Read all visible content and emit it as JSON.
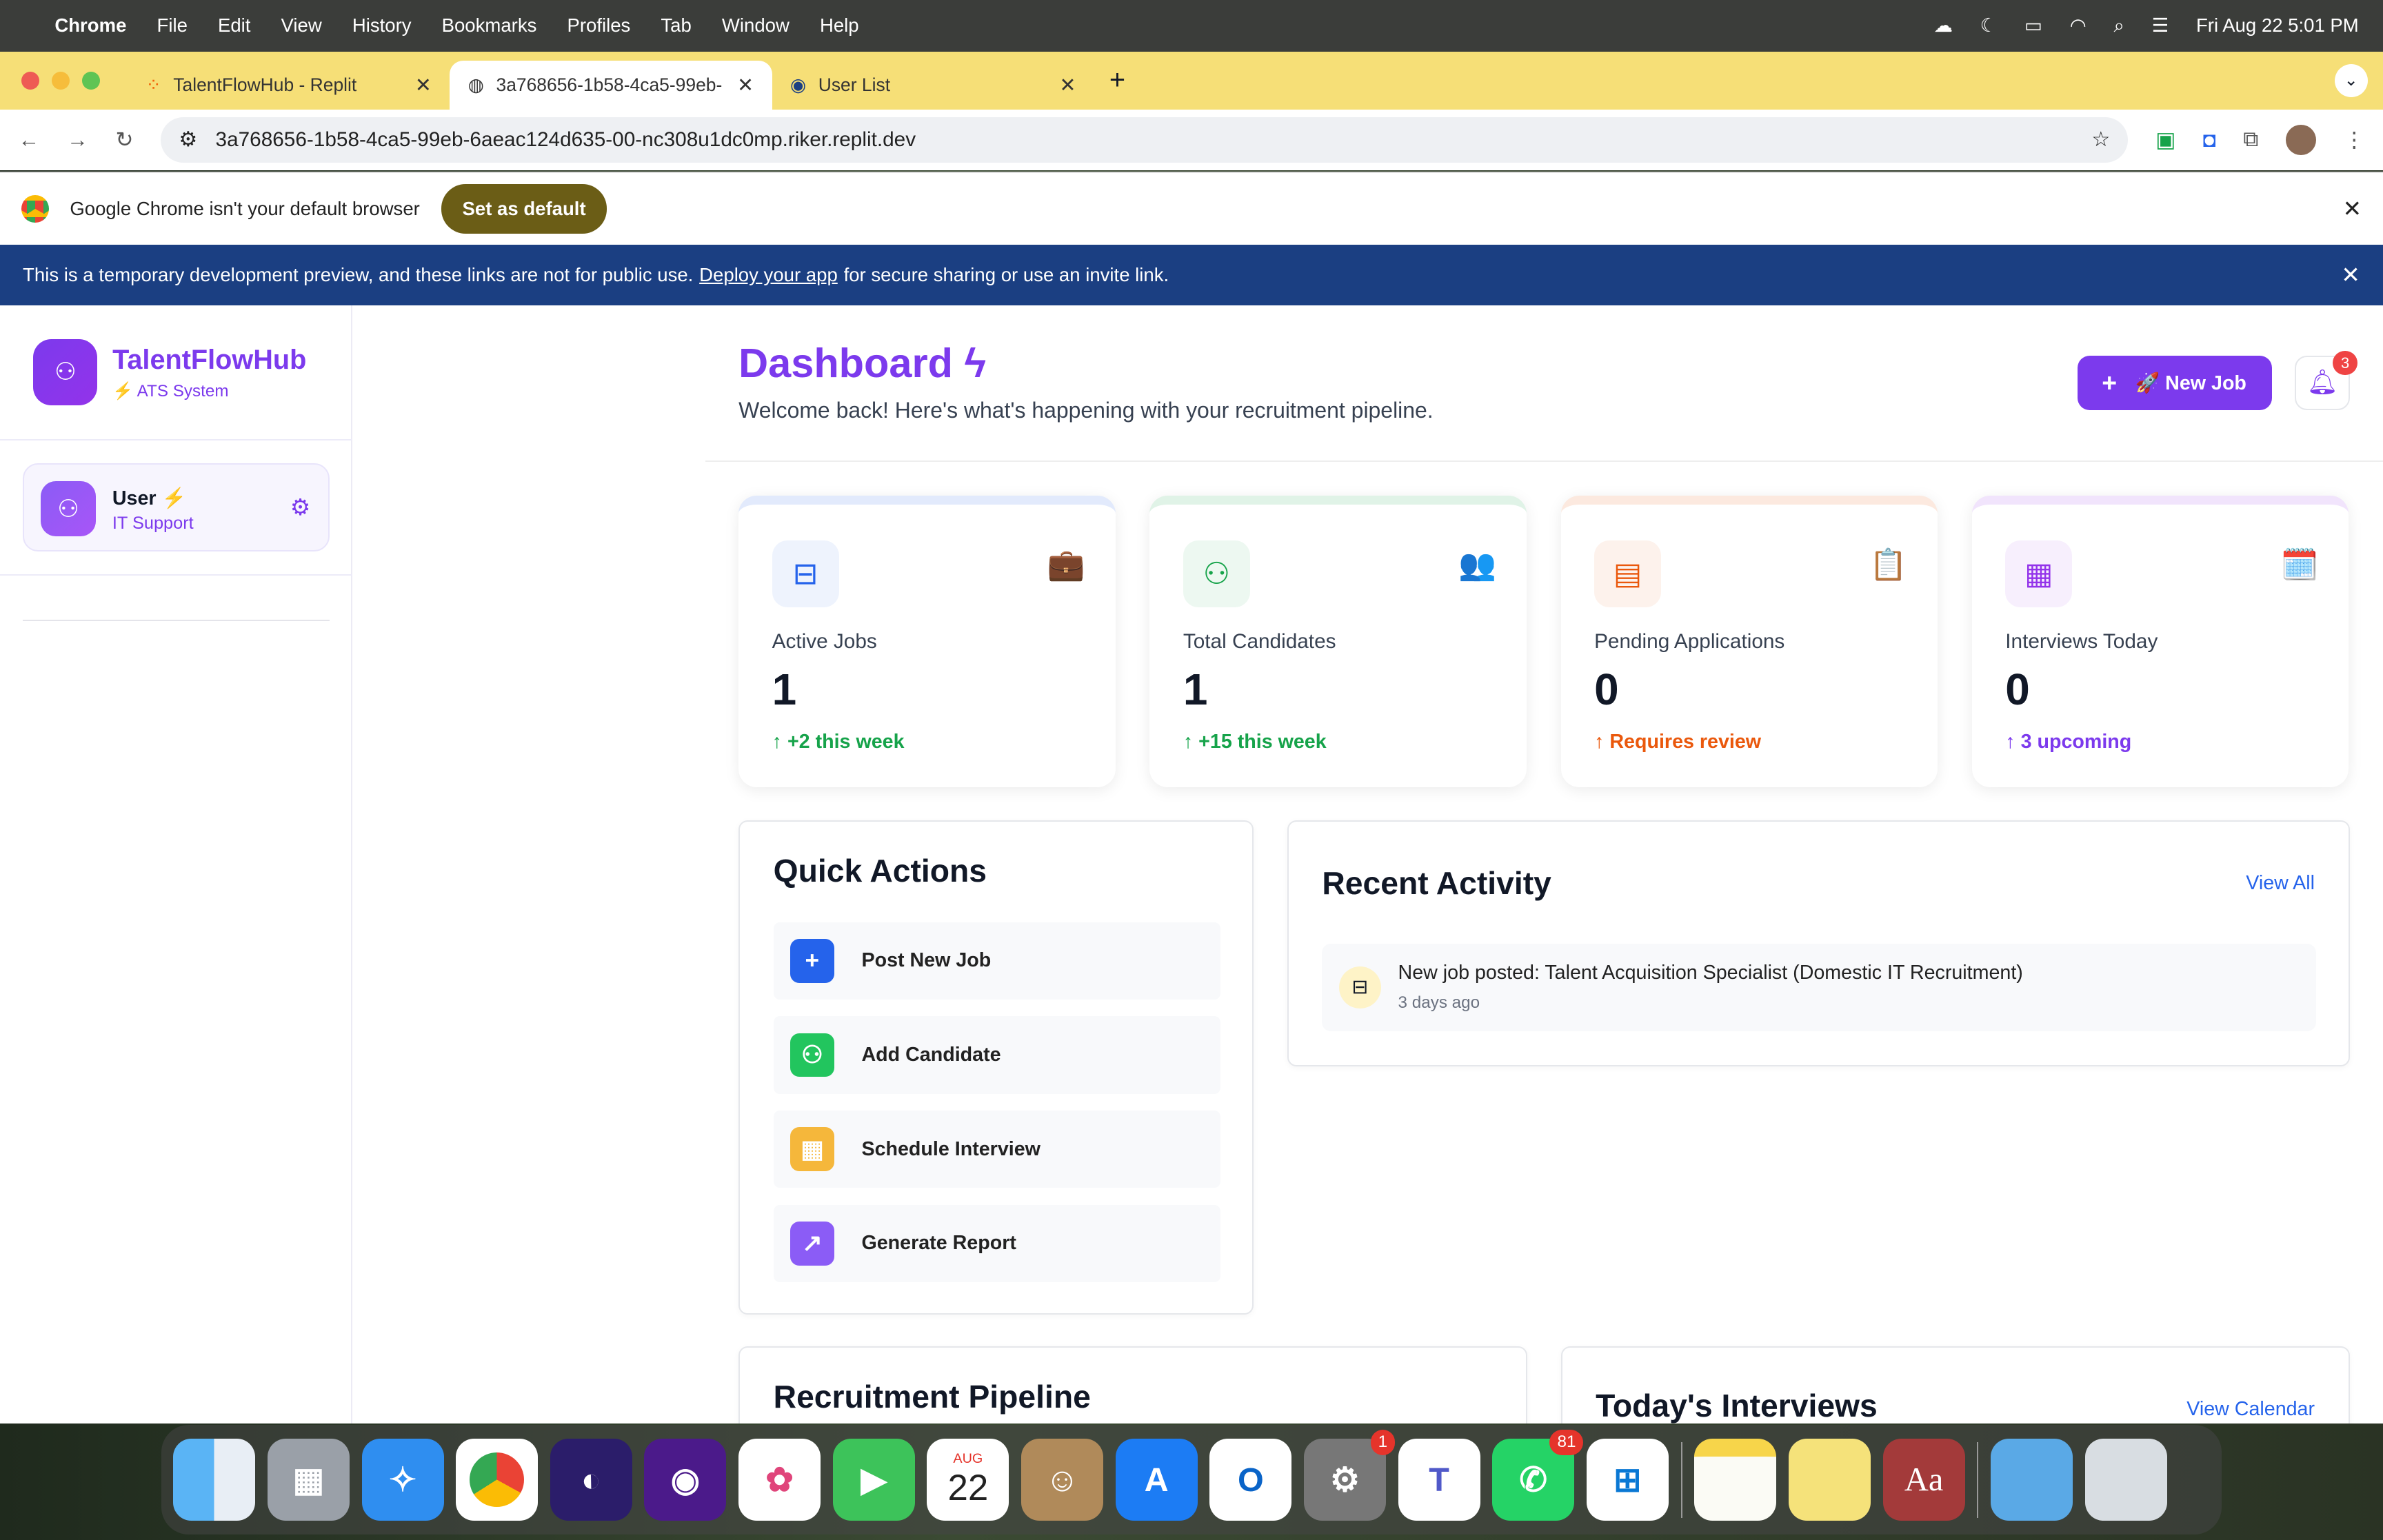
{
  "menubar": {
    "app": "Chrome",
    "items": [
      "File",
      "Edit",
      "View",
      "History",
      "Bookmarks",
      "Profiles",
      "Tab",
      "Window",
      "Help"
    ],
    "datetime": "Fri Aug 22  5:01 PM"
  },
  "tabs": [
    {
      "title": "TalentFlowHub - Replit"
    },
    {
      "title": "3a768656-1b58-4ca5-99eb-"
    },
    {
      "title": "User List"
    }
  ],
  "address": {
    "url": "3a768656-1b58-4ca5-99eb-6aeac124d635-00-nc308u1dc0mp.riker.replit.dev"
  },
  "infobar": {
    "text": "Google Chrome isn't your default browser",
    "button": "Set as default"
  },
  "banner": {
    "pre": "This is a temporary development preview, and these links are not for public use.",
    "link": "Deploy your app",
    "post": "for secure sharing or use an invite link."
  },
  "sidebar": {
    "brand": "TalentFlowHub",
    "subtitle": "⚡ ATS System",
    "user": {
      "name": "User",
      "role": "IT Support"
    }
  },
  "header": {
    "title": "Dashboard",
    "subtitle": "Welcome back! Here's what's happening with your recruitment pipeline.",
    "new_job": "🚀 New Job",
    "notifications": "3"
  },
  "stats": [
    {
      "label": "Active Jobs",
      "value": "1",
      "delta": "+2 this week",
      "color": "#16a34a",
      "accent": "#2563eb",
      "emoji": "💼"
    },
    {
      "label": "Total Candidates",
      "value": "1",
      "delta": "+15 this week",
      "color": "#16a34a",
      "accent": "#16a34a",
      "emoji": "👥"
    },
    {
      "label": "Pending Applications",
      "value": "0",
      "delta": "Requires review",
      "color": "#ea580c",
      "accent": "#ea580c",
      "emoji": "📋"
    },
    {
      "label": "Interviews Today",
      "value": "0",
      "delta": "3 upcoming",
      "color": "#7c3aed",
      "accent": "#9333ea",
      "emoji": "🗓️"
    }
  ],
  "quick_actions": {
    "title": "Quick Actions",
    "items": [
      {
        "label": "Post New Job",
        "icon": "plus-icon",
        "color": "#2563eb"
      },
      {
        "label": "Add Candidate",
        "icon": "user-plus-icon",
        "color": "#22c55e"
      },
      {
        "label": "Schedule Interview",
        "icon": "calendar-icon",
        "color": "#f5b73b"
      },
      {
        "label": "Generate Report",
        "icon": "trending-up-icon",
        "color": "#8b5cf6"
      }
    ]
  },
  "recent_activity": {
    "title": "Recent Activity",
    "view_all": "View All",
    "items": [
      {
        "text": "New job posted: Talent Acquisition Specialist (Domestic IT Recruitment)",
        "time": "3 days ago"
      }
    ]
  },
  "pipeline": {
    "title": "Recruitment Pipeline"
  },
  "interviews": {
    "title": "Today's Interviews",
    "view_calendar": "View Calendar"
  },
  "dock": {
    "calendar_month": "AUG",
    "calendar_day": "22",
    "settings_badge": "1",
    "whatsapp_badge": "81"
  }
}
